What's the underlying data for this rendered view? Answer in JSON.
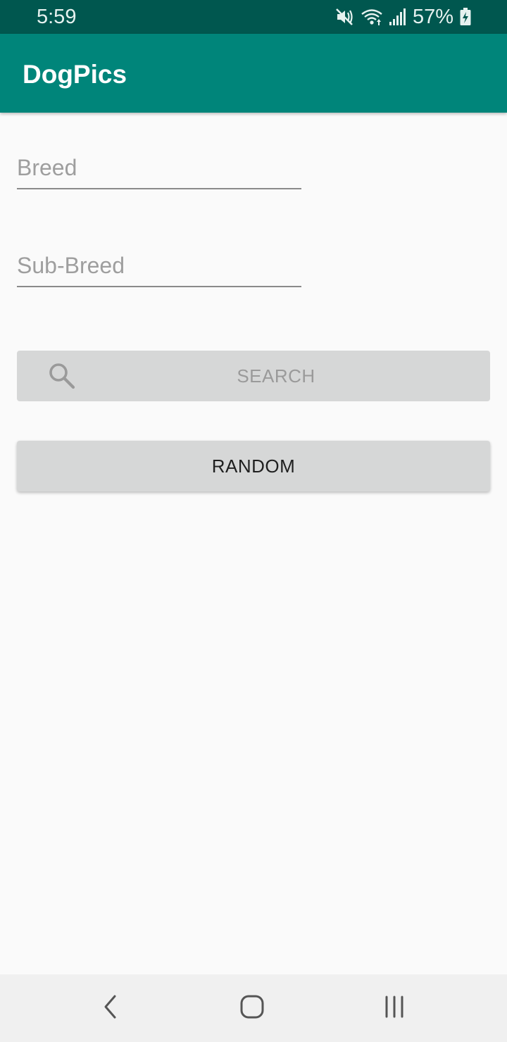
{
  "status_bar": {
    "time": "5:59",
    "battery_percent": "57%",
    "icons": [
      "mute-icon",
      "wifi-icon",
      "signal-icon",
      "battery-charging-icon"
    ]
  },
  "app_bar": {
    "title": "DogPics",
    "color": "#00857a"
  },
  "form": {
    "breed": {
      "value": "",
      "placeholder": "Breed"
    },
    "sub_breed": {
      "value": "",
      "placeholder": "Sub-Breed"
    }
  },
  "buttons": {
    "search": {
      "label": "SEARCH",
      "icon": "search-icon",
      "enabled": false
    },
    "random": {
      "label": "RANDOM",
      "enabled": true
    }
  },
  "navigation": {
    "items": [
      "back-icon",
      "home-icon",
      "recent-apps-icon"
    ]
  },
  "colors": {
    "status_bar": "#00574f",
    "app_bar": "#00857a",
    "background": "#fafafa",
    "button": "#d6d7d7"
  }
}
